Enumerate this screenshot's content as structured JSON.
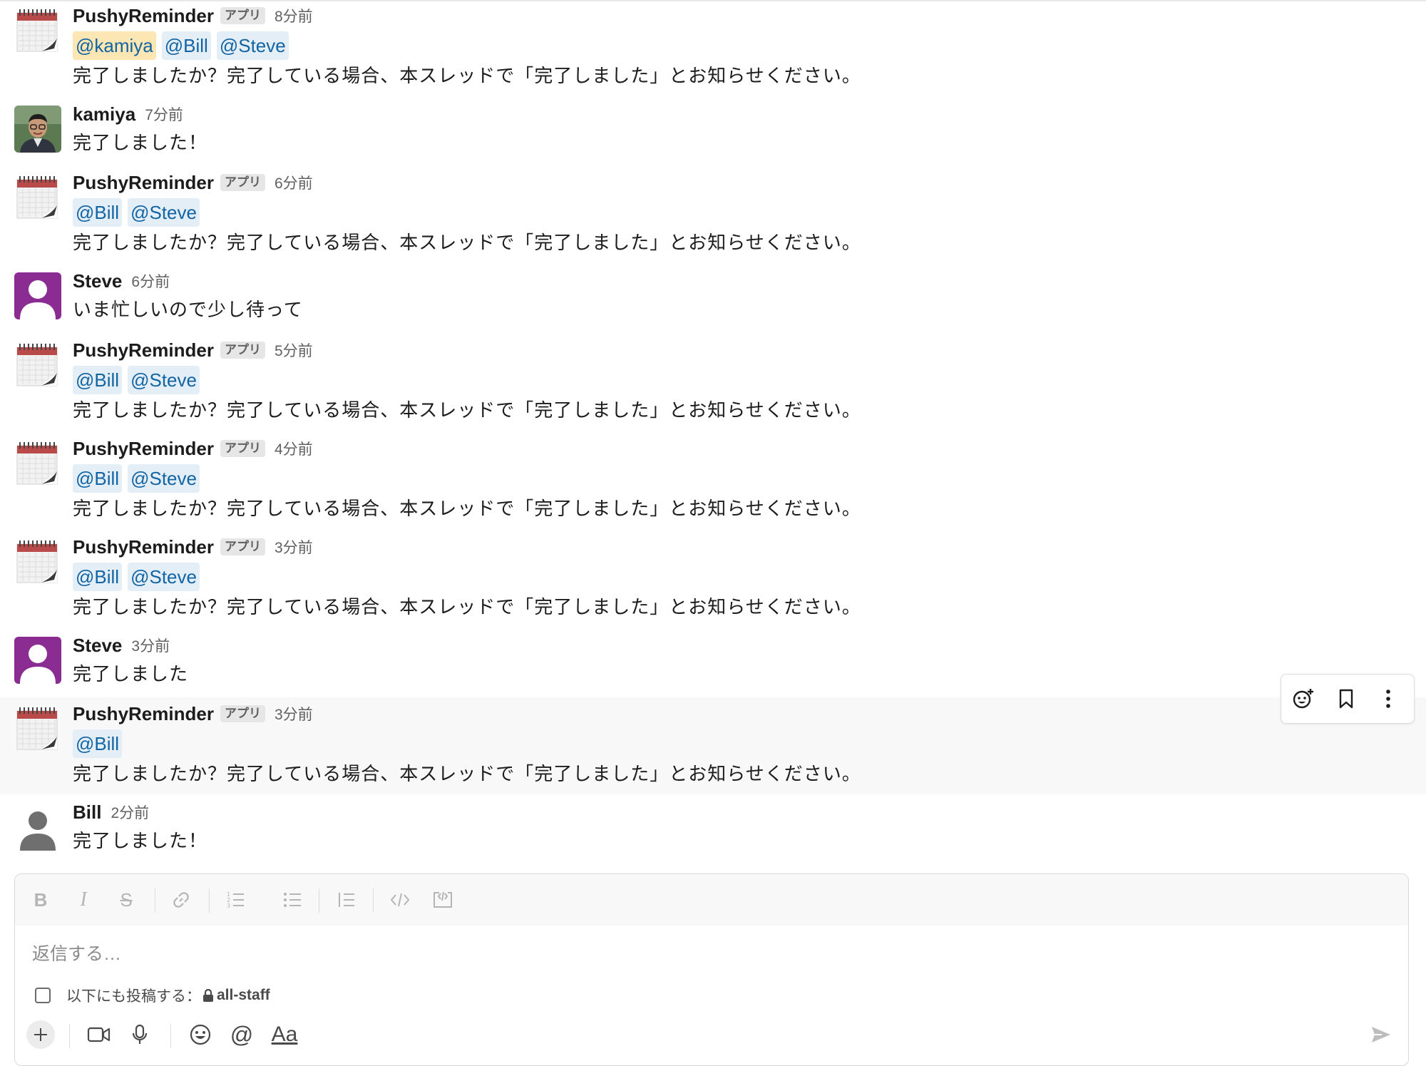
{
  "thread": {
    "messages": [
      {
        "sender": "PushyReminder",
        "is_app": true,
        "app_tag": "アプリ",
        "time": "8分前",
        "mentions": [
          {
            "text": "@kamiya",
            "self": true
          },
          {
            "text": "@Bill",
            "self": false
          },
          {
            "text": "@Steve",
            "self": false
          }
        ],
        "text": "完了しましたか？完了している場合、本スレッドで「完了しました」とお知らせください。",
        "avatar": "calendar-avatar"
      },
      {
        "sender": "kamiya",
        "is_app": false,
        "time": "7分前",
        "mentions": [],
        "text": "完了しました！",
        "avatar": "photo-avatar"
      },
      {
        "sender": "PushyReminder",
        "is_app": true,
        "app_tag": "アプリ",
        "time": "6分前",
        "mentions": [
          {
            "text": "@Bill",
            "self": false
          },
          {
            "text": "@Steve",
            "self": false
          }
        ],
        "text": "完了しましたか？完了している場合、本スレッドで「完了しました」とお知らせください。",
        "avatar": "calendar-avatar"
      },
      {
        "sender": "Steve",
        "is_app": false,
        "time": "6分前",
        "mentions": [],
        "text": "いま忙しいので少し待って",
        "avatar": "purple-user-avatar"
      },
      {
        "sender": "PushyReminder",
        "is_app": true,
        "app_tag": "アプリ",
        "time": "5分前",
        "mentions": [
          {
            "text": "@Bill",
            "self": false
          },
          {
            "text": "@Steve",
            "self": false
          }
        ],
        "text": "完了しましたか？完了している場合、本スレッドで「完了しました」とお知らせください。",
        "avatar": "calendar-avatar"
      },
      {
        "sender": "PushyReminder",
        "is_app": true,
        "app_tag": "アプリ",
        "time": "4分前",
        "mentions": [
          {
            "text": "@Bill",
            "self": false
          },
          {
            "text": "@Steve",
            "self": false
          }
        ],
        "text": "完了しましたか？完了している場合、本スレッドで「完了しました」とお知らせください。",
        "avatar": "calendar-avatar"
      },
      {
        "sender": "PushyReminder",
        "is_app": true,
        "app_tag": "アプリ",
        "time": "3分前",
        "mentions": [
          {
            "text": "@Bill",
            "self": false
          },
          {
            "text": "@Steve",
            "self": false
          }
        ],
        "text": "完了しましたか？完了している場合、本スレッドで「完了しました」とお知らせください。",
        "avatar": "calendar-avatar"
      },
      {
        "sender": "Steve",
        "is_app": false,
        "time": "3分前",
        "mentions": [],
        "text": "完了しました",
        "avatar": "purple-user-avatar"
      },
      {
        "sender": "PushyReminder",
        "is_app": true,
        "app_tag": "アプリ",
        "time": "3分前",
        "mentions": [
          {
            "text": "@Bill",
            "self": false
          }
        ],
        "text": "完了しましたか？完了している場合、本スレッドで「完了しました」とお知らせください。",
        "avatar": "calendar-avatar",
        "hovered": true
      },
      {
        "sender": "Bill",
        "is_app": false,
        "time": "2分前",
        "mentions": [],
        "text": "完了しました！",
        "avatar": "gray-user-avatar"
      }
    ]
  },
  "hover_toolbar": {
    "icons": [
      "add-reaction-icon",
      "bookmark-icon",
      "more-actions-icon"
    ]
  },
  "composer": {
    "format_icons": [
      "bold-icon",
      "italic-icon",
      "strikethrough-icon",
      "link-icon",
      "ordered-list-icon",
      "bulleted-list-icon",
      "blockquote-icon",
      "code-icon",
      "code-block-icon"
    ],
    "format_glyphs": {
      "bold": "B",
      "italic": "I",
      "strike": "S"
    },
    "placeholder": "返信する…",
    "also_post_label": "以下にも投稿する：",
    "also_post_channel": "all-staff",
    "bottom_icons": [
      "plus-icon",
      "video-icon",
      "microphone-icon",
      "emoji-icon",
      "mention-icon",
      "text-format-icon",
      "send-icon"
    ],
    "mention_glyph": "@",
    "text_format_glyph": "Aa"
  },
  "colors": {
    "mention_bg": "#e3eef7",
    "mention_text": "#1264a3",
    "self_mention_bg": "#fbe6b4",
    "purple_avatar": "#8a2c92",
    "hover_bg": "#f8f8f8"
  }
}
